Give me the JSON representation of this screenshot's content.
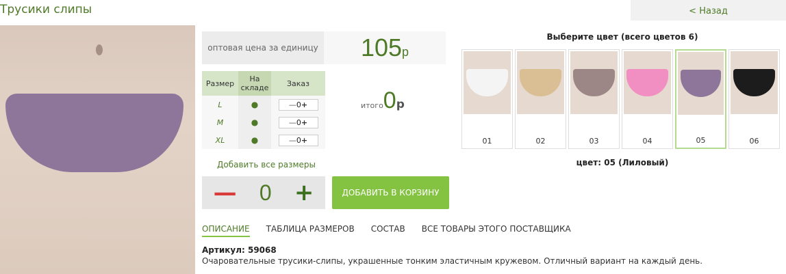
{
  "title": "Трусики слипы",
  "back_label": "< Назад",
  "price": {
    "label": "оптовая цена за единицу",
    "value": "105",
    "currency": "р"
  },
  "size_table": {
    "headers": [
      "Размер",
      "На складе",
      "Заказ"
    ],
    "rows": [
      {
        "size": "L",
        "stock": "●",
        "qty": "0"
      },
      {
        "size": "M",
        "stock": "●",
        "qty": "0"
      },
      {
        "size": "XL",
        "stock": "●",
        "qty": "0"
      }
    ],
    "minus": "—",
    "plus": "+"
  },
  "total": {
    "label": "итого",
    "value": "0",
    "currency": "р"
  },
  "add_all_label": "Добавить все размеры",
  "qty": {
    "minus": "—",
    "value": "0",
    "plus": "+"
  },
  "cart_button": "ДОБАВИТЬ В КОРЗИНУ",
  "tabs": [
    "ОПИСАНИЕ",
    "ТАБЛИЦА РАЗМЕРОВ",
    "СОСТАВ",
    "ВСЕ ТОВАРЫ ЭТОГО ПОСТАВЩИКА"
  ],
  "article": "Артикул: 59068",
  "description": "Очаровательные трусики-слипы, украшенные тонким эластичным кружевом. Отличный вариант на каждый день.",
  "colors": {
    "header": "Выберите цвет (всего цветов 6)",
    "items": [
      {
        "num": "01",
        "color": "#f4f4f4"
      },
      {
        "num": "02",
        "color": "#d9bf93"
      },
      {
        "num": "03",
        "color": "#9d8686"
      },
      {
        "num": "04",
        "color": "#f28fc2"
      },
      {
        "num": "05",
        "color": "#8d7699",
        "selected": true
      },
      {
        "num": "06",
        "color": "#1c1c1c"
      }
    ],
    "selected_label": "цвет: 05 (Лиловый)"
  }
}
